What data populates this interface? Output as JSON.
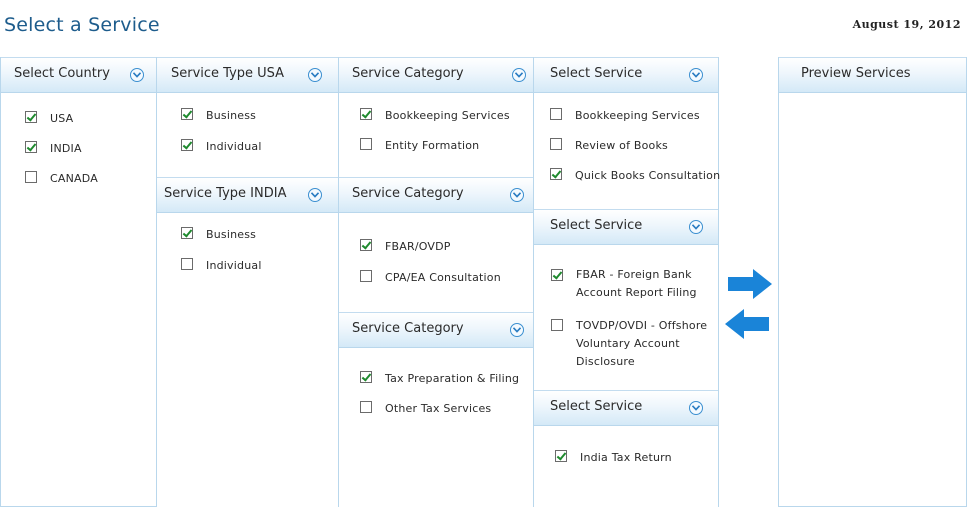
{
  "header": {
    "title": "Select a Service",
    "date": "August 19, 2012"
  },
  "colors": {
    "title": "#1d5c8c",
    "header_gradient_bottom": "#d4e9f7",
    "border": "#b9d7ec",
    "check": "#1e8a2e",
    "arrow": "#1a84d8"
  },
  "country": {
    "title": "Select Country",
    "items": [
      {
        "label": "USA",
        "checked": true
      },
      {
        "label": "INDIA",
        "checked": true
      },
      {
        "label": "CANADA",
        "checked": false
      }
    ]
  },
  "service_type_usa": {
    "title": "Service Type  USA",
    "items": [
      {
        "label": "Business",
        "checked": true
      },
      {
        "label": "Individual",
        "checked": true
      }
    ]
  },
  "service_type_india": {
    "title": "Service Type  INDIA",
    "items": [
      {
        "label": "Business",
        "checked": true
      },
      {
        "label": "Individual",
        "checked": false
      }
    ]
  },
  "category_1": {
    "title": "Service Category",
    "items": [
      {
        "label": "Bookkeeping Services",
        "checked": true
      },
      {
        "label": "Entity Formation",
        "checked": false
      }
    ]
  },
  "category_2": {
    "title": "Service Category",
    "items": [
      {
        "label": "FBAR/OVDP",
        "checked": true
      },
      {
        "label": "CPA/EA Consultation",
        "checked": false
      }
    ]
  },
  "category_3": {
    "title": "Service Category",
    "items": [
      {
        "label": "Tax Preparation & Filing",
        "checked": true
      },
      {
        "label": "Other Tax Services",
        "checked": false
      }
    ]
  },
  "service_1": {
    "title": "Select Service",
    "items": [
      {
        "label": "Bookkeeping Services",
        "checked": false
      },
      {
        "label": "Review of Books",
        "checked": false
      },
      {
        "label": "Quick Books Consultation",
        "checked": true
      }
    ]
  },
  "service_2": {
    "title": "Select Service",
    "items": [
      {
        "label": "FBAR - Foreign Bank Account Report Filing",
        "checked": true
      },
      {
        "label": "TOVDP/OVDI - Offshore Voluntary Account Disclosure",
        "checked": false
      }
    ]
  },
  "service_3": {
    "title": "Select Service",
    "items": [
      {
        "label": "India Tax Return",
        "checked": true
      }
    ]
  },
  "preview": {
    "title": "Preview Services"
  },
  "icons": {
    "chevron": "chevron-down-circle-icon",
    "add": "arrow-right-icon",
    "remove": "arrow-left-icon"
  }
}
